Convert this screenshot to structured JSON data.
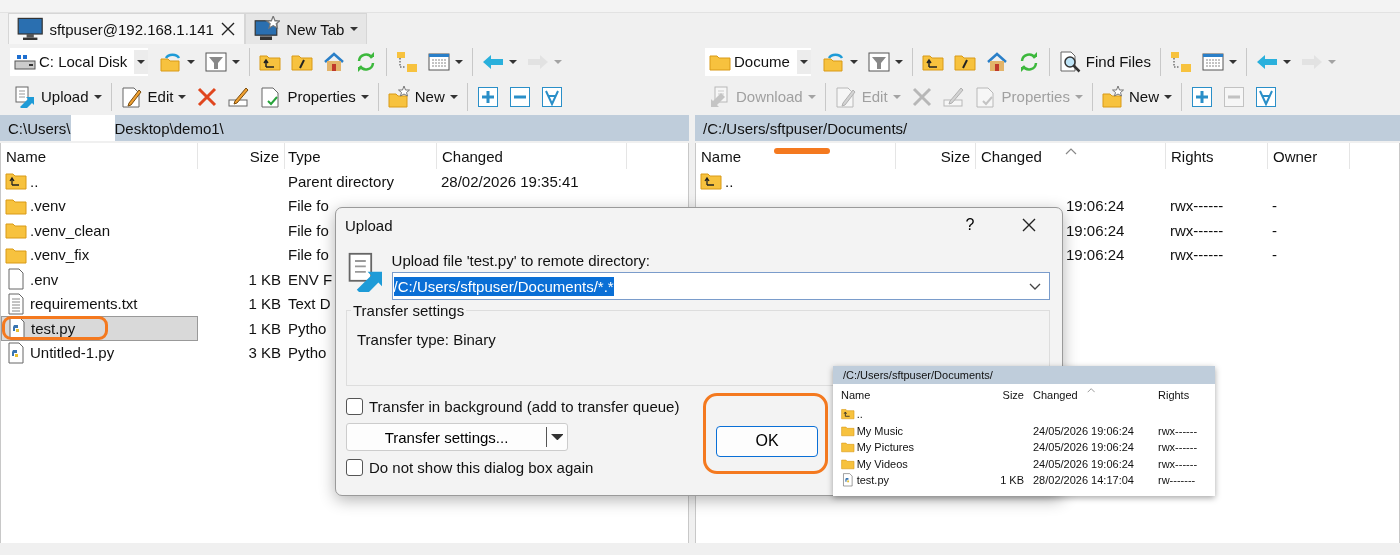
{
  "tabs": [
    {
      "label": "sftpuser@192.168.1.141",
      "selected": true,
      "closable": true
    },
    {
      "label": "New Tab",
      "selected": false,
      "closable": false
    }
  ],
  "left": {
    "toolbar_top": [
      [
        {
          "kind": "combo",
          "label": "C: Local Disk",
          "disabled": false,
          "dropdown": true
        },
        {
          "kind": "button",
          "disabled": false,
          "dropdown": true
        },
        {
          "kind": "button",
          "disabled": false,
          "dropdown": true
        }
      ],
      [
        {
          "kind": "button",
          "disabled": false,
          "dropdown": false
        },
        {
          "kind": "button",
          "disabled": false,
          "dropdown": false
        },
        {
          "kind": "button",
          "disabled": false,
          "dropdown": false
        },
        {
          "kind": "button",
          "disabled": false,
          "dropdown": false
        }
      ],
      [
        {
          "kind": "button",
          "disabled": false,
          "dropdown": false
        },
        {
          "kind": "button",
          "disabled": false,
          "dropdown": true
        }
      ],
      [
        {
          "kind": "button",
          "disabled": false,
          "dropdown": true
        },
        {
          "kind": "button",
          "disabled": true,
          "dropdown": true
        }
      ]
    ],
    "toolbar_bottom": [
      [
        {
          "label": "Upload",
          "disabled": false,
          "dropdown": true
        }
      ],
      [
        {
          "label": "Edit",
          "disabled": false,
          "dropdown": true
        },
        {
          "disabled": false,
          "dropdown": false
        },
        {
          "disabled": false,
          "dropdown": false
        },
        {
          "label": "Properties",
          "disabled": false,
          "dropdown": true
        }
      ],
      [
        {
          "label": "New",
          "disabled": false,
          "dropdown": true
        }
      ],
      [
        {
          "disabled": false,
          "dropdown": false
        },
        {
          "disabled": false,
          "dropdown": false
        },
        {
          "disabled": false,
          "dropdown": false
        }
      ]
    ],
    "path": [
      "C:\\Users\\",
      "Desktop\\demo1\\"
    ],
    "columns": [
      {
        "label": "Name",
        "sorted": false
      },
      {
        "label": "Size",
        "sorted": false
      },
      {
        "label": "Type",
        "sorted": false
      },
      {
        "label": "Changed",
        "sorted": false
      }
    ],
    "rows": [
      {
        "kind": "parent",
        "name": "..",
        "size": "",
        "type": "Parent directory",
        "changed": "28/02/2026 19:35:41",
        "selected": false
      },
      {
        "kind": "folder",
        "name": ".venv",
        "size": "",
        "type": "File fo",
        "changed": "",
        "selected": false
      },
      {
        "kind": "folder",
        "name": ".venv_clean",
        "size": "",
        "type": "File fo",
        "changed": "",
        "selected": false
      },
      {
        "kind": "folder",
        "name": ".venv_fix",
        "size": "",
        "type": "File fo",
        "changed": "",
        "selected": false
      },
      {
        "kind": "file",
        "name": ".env",
        "size": "1 KB",
        "type": "ENV F",
        "changed": "",
        "selected": false
      },
      {
        "kind": "text",
        "name": "requirements.txt",
        "size": "1 KB",
        "type": "Text D",
        "changed": "",
        "selected": false
      },
      {
        "kind": "python",
        "name": "test.py",
        "size": "1 KB",
        "type": "Pytho",
        "changed": "",
        "selected": true
      },
      {
        "kind": "python",
        "name": "Untitled-1.py",
        "size": "3 KB",
        "type": "Pytho",
        "changed": "",
        "selected": false
      }
    ]
  },
  "right": {
    "toolbar_top": [
      [
        {
          "kind": "combo",
          "label": "Docume",
          "disabled": false,
          "dropdown": true
        },
        {
          "kind": "button",
          "disabled": false,
          "dropdown": true
        },
        {
          "kind": "button",
          "disabled": false,
          "dropdown": true
        }
      ],
      [
        {
          "kind": "button",
          "disabled": false,
          "dropdown": false
        },
        {
          "kind": "button",
          "disabled": false,
          "dropdown": false
        },
        {
          "kind": "button",
          "disabled": false,
          "dropdown": false
        },
        {
          "kind": "button",
          "disabled": false,
          "dropdown": false
        }
      ],
      [
        {
          "kind": "button",
          "label": "Find Files",
          "disabled": false,
          "dropdown": false
        }
      ],
      [
        {
          "kind": "button",
          "disabled": false,
          "dropdown": false
        },
        {
          "kind": "button",
          "disabled": false,
          "dropdown": true
        }
      ],
      [
        {
          "kind": "button",
          "disabled": false,
          "dropdown": true
        },
        {
          "kind": "button",
          "disabled": true,
          "dropdown": true
        }
      ]
    ],
    "toolbar_bottom": [
      [
        {
          "label": "Download",
          "disabled": true,
          "dropdown": true
        }
      ],
      [
        {
          "label": "Edit",
          "disabled": true,
          "dropdown": true
        },
        {
          "disabled": true,
          "dropdown": false
        },
        {
          "disabled": true,
          "dropdown": false
        },
        {
          "label": "Properties",
          "disabled": true,
          "dropdown": true
        }
      ],
      [
        {
          "label": "New",
          "disabled": false,
          "dropdown": true
        }
      ],
      [
        {
          "disabled": false,
          "dropdown": false
        },
        {
          "disabled": true,
          "dropdown": false
        },
        {
          "disabled": false,
          "dropdown": false
        }
      ]
    ],
    "path": "/C:/Users/sftpuser/Documents/",
    "columns": [
      {
        "label": "Name",
        "sorted": false
      },
      {
        "label": "Size",
        "sorted": false
      },
      {
        "label": "Changed",
        "sorted": true
      },
      {
        "label": "Rights",
        "sorted": false
      },
      {
        "label": "Owner",
        "sorted": false
      }
    ],
    "rows": [
      {
        "kind": "parent",
        "name": "..",
        "size": "",
        "changed": "",
        "rights": "",
        "owner": ""
      },
      {
        "changed": "19:06:24",
        "rights": "rwx------",
        "owner": "-"
      },
      {
        "changed": "19:06:24",
        "rights": "rwx------",
        "owner": "-"
      },
      {
        "changed": "19:06:24",
        "rights": "rwx------",
        "owner": "-"
      }
    ]
  },
  "dialog": {
    "title": "Upload",
    "help": "?",
    "prompt": "Upload file 'test.py' to remote directory:",
    "value": "/C:/Users/sftpuser/Documents/*.*",
    "group_title": "Transfer settings",
    "transfer_type": "Transfer type: Binary",
    "background": {
      "label": "Transfer in background (add to transfer queue)",
      "checked": false
    },
    "settings_button": "Transfer settings...",
    "dont_show": {
      "label": "Do not show this dialog box again",
      "checked": false
    },
    "ok": "OK"
  },
  "inset": {
    "path": "/C:/Users/sftpuser/Documents/",
    "columns": [
      {
        "label": "Name",
        "sorted": false
      },
      {
        "label": "Size",
        "sorted": false
      },
      {
        "label": "Changed",
        "sorted": true
      },
      {
        "label": "Rights",
        "sorted": false
      }
    ],
    "rows": [
      {
        "kind": "parent",
        "name": "..",
        "size": "",
        "changed": "",
        "rights": ""
      },
      {
        "kind": "folder",
        "name": "My Music",
        "size": "",
        "changed": "24/05/2026 19:06:24",
        "rights": "rwx------"
      },
      {
        "kind": "folder",
        "name": "My Pictures",
        "size": "",
        "changed": "24/05/2026 19:06:24",
        "rights": "rwx------"
      },
      {
        "kind": "folder",
        "name": "My Videos",
        "size": "",
        "changed": "24/05/2026 19:06:24",
        "rights": "rwx------"
      },
      {
        "kind": "python",
        "name": "test.py",
        "size": "1 KB",
        "changed": "28/02/2026 14:17:04",
        "rights": "rw-------"
      }
    ]
  }
}
